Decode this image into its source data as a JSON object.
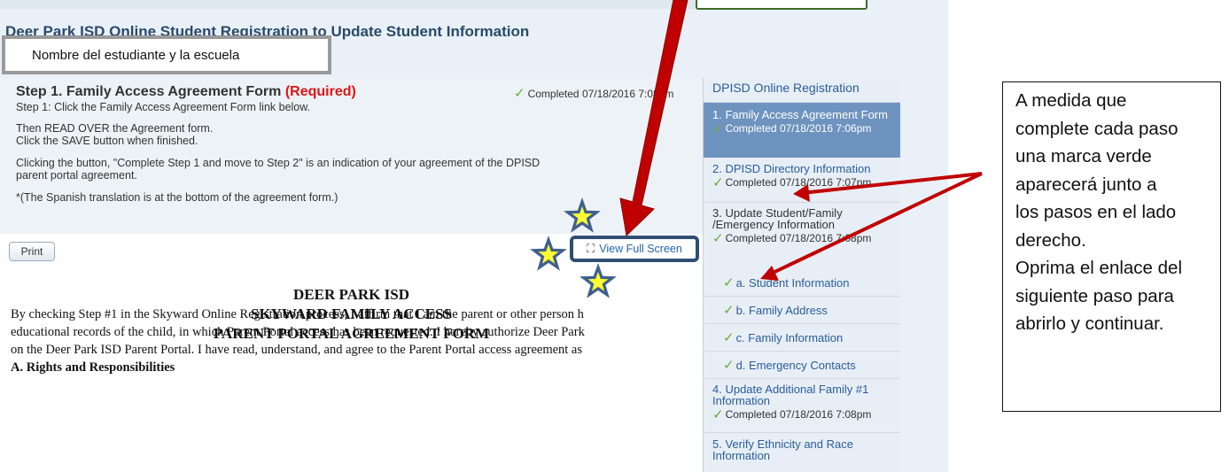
{
  "page": {
    "title": "Deer Park ISD Online Student Registration to Update Student Information"
  },
  "callout_name": {
    "text": "Nombre del estudiante y la  escuela"
  },
  "step": {
    "title": "Step 1. Family Access Agreement Form",
    "required": "(Required)",
    "completed": "Completed 07/18/2016 7:08pm",
    "instructions": [
      "Step 1: Click the Family Access Agreement Form link below.",
      "Then READ OVER the Agreement form.",
      "Click the SAVE button when finished.",
      "Clicking the button, \"Complete Step 1 and move to Step 2\" is an indication of your agreement of the DPISD",
      "parent portal agreement.",
      "*(The Spanish translation is at the bottom of the agreement form.)"
    ]
  },
  "toolbar": {
    "print_label": "Print",
    "view_full_screen_label": "View Full Screen"
  },
  "document": {
    "title_lines": [
      "DEER PARK ISD",
      "SKYWARD FAMILY ACCESS",
      "PARENT PORTAL AGREEMENT FORM"
    ],
    "body_lines": [
      "By checking Step #1 in the Skyward Online Registration process, I affirm that I am the parent or other person h",
      "educational records of the child, in which Parent Portal access has been requested. I hereby authorize Deer Park",
      "on the Deer Park ISD Parent Portal. I have read, understand, and agree to the Parent Portal access agreement as",
      "A. Rights and Responsibilities"
    ]
  },
  "sidebar": {
    "header": "DPISD Online Registration",
    "steps": [
      {
        "label": "1. Family Access Agreement Form",
        "completed": "Completed 07/18/2016 7:06pm"
      },
      {
        "label": "2. DPISD Directory Information",
        "completed": "Completed 07/18/2016 7:07pm"
      },
      {
        "label": "3. Update Student/Family /Emergency Information",
        "completed": "Completed 07/18/2016 7:08pm"
      },
      {
        "label": "4. Update Additional Family #1 Information",
        "completed": "Completed 07/18/2016 7:08pm"
      },
      {
        "label": "5. Verify Ethnicity and Race Information"
      }
    ],
    "substeps": [
      "a. Student Information",
      "b. Family Address",
      "c. Family Information",
      "d. Emergency Contacts"
    ]
  },
  "callout_right": {
    "lines": [
      "A medida que",
      "complete cada paso",
      "una marca verde",
      "aparecerá  junto a",
      "los pasos en el lado",
      "derecho.",
      "Oprima el enlace del",
      "siguiente paso para",
      "abrirlo y continuar."
    ]
  },
  "icons": {
    "check": "check-icon",
    "fullscreen": "fullscreen-icon",
    "star": "star-icon",
    "arrow": "arrow-icon"
  },
  "colors": {
    "required": "#e01515",
    "active_step": "#6e93bf",
    "arrow": "#c00000",
    "star_fill": "#ffff33",
    "star_stroke": "#3f5f8f"
  }
}
